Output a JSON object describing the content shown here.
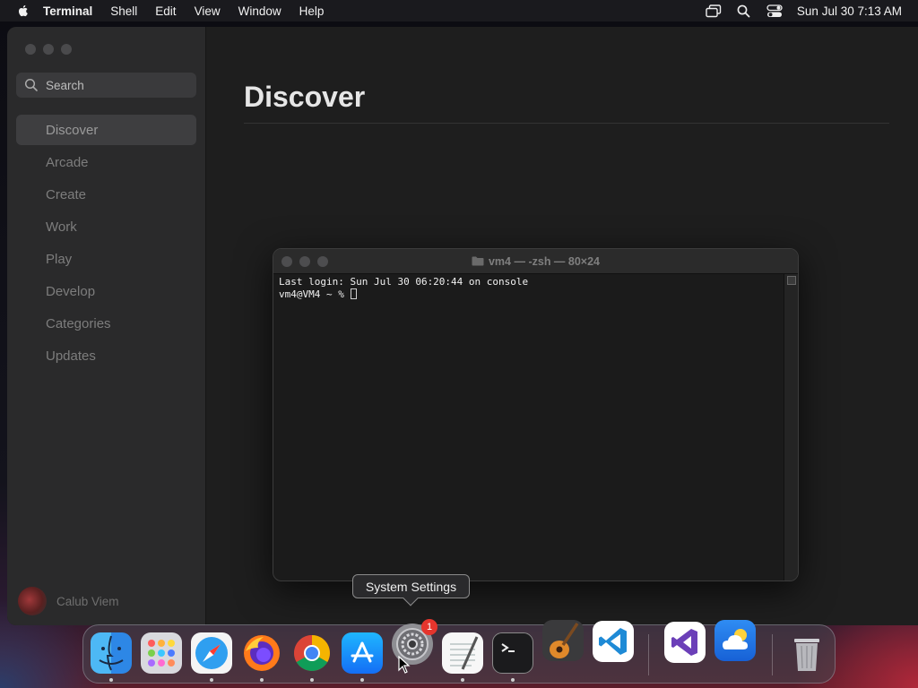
{
  "menubar": {
    "app_name": "Terminal",
    "items": [
      "Shell",
      "Edit",
      "View",
      "Window",
      "Help"
    ],
    "clock": "Sun Jul 30  7:13 AM",
    "icons": [
      "apple-icon",
      "screen-mirroring-icon",
      "spotlight-search-icon",
      "control-center-icon"
    ]
  },
  "appstore": {
    "search_placeholder": "Search",
    "nav": [
      "Discover",
      "Arcade",
      "Create",
      "Work",
      "Play",
      "Develop",
      "Categories",
      "Updates"
    ],
    "active_nav": "Discover",
    "page_title": "Discover",
    "user_name": "Calub Viem"
  },
  "terminal": {
    "title": "vm4 — -zsh — 80×24",
    "lines": [
      "Last login: Sun Jul 30 06:20:44 on console"
    ],
    "prompt": "vm4@VM4 ~ % "
  },
  "tooltip": "System Settings",
  "dock": {
    "apps": [
      {
        "name": "Finder",
        "icon": "finder-icon",
        "running": true
      },
      {
        "name": "Launchpad",
        "icon": "launchpad-icon",
        "running": false
      },
      {
        "name": "Safari",
        "icon": "safari-icon",
        "running": true
      },
      {
        "name": "Firefox",
        "icon": "firefox-icon",
        "running": true
      },
      {
        "name": "Chrome",
        "icon": "chrome-icon",
        "running": true
      },
      {
        "name": "App Store",
        "icon": "app-store-icon",
        "running": true
      },
      {
        "name": "System Settings",
        "icon": "system-settings-icon",
        "running": false,
        "badge": "1"
      },
      {
        "name": "TextEdit",
        "icon": "textedit-icon",
        "running": true
      },
      {
        "name": "Terminal",
        "icon": "terminal-icon",
        "running": true
      },
      {
        "name": "GarageBand",
        "icon": "garageband-icon",
        "running": false
      },
      {
        "name": "Visual Studio Code",
        "icon": "vscode-icon",
        "running": false
      },
      {
        "name": "Visual Studio",
        "icon": "visual-studio-icon",
        "running": false
      },
      {
        "name": "Weather",
        "icon": "weather-icon",
        "running": false
      },
      {
        "name": "Trash",
        "icon": "trash-icon",
        "running": false
      }
    ]
  },
  "colors": {
    "badge": "#e5352d",
    "vscode_blue": "#1e8ad6",
    "visual_studio_purple": "#6b3fb8"
  }
}
